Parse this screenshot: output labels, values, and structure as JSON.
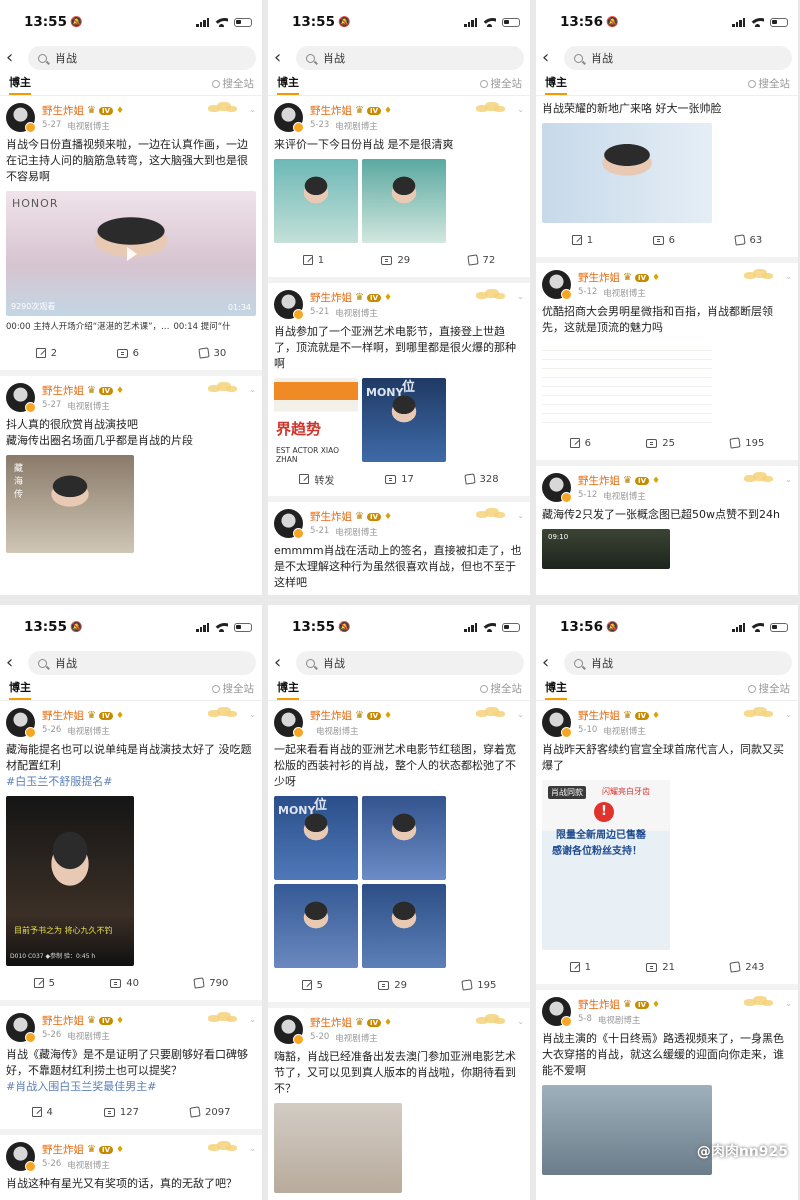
{
  "status": [
    {
      "time": "13:55"
    },
    {
      "time": "13:55"
    },
    {
      "time": "13:56"
    },
    {
      "time": "13:55"
    },
    {
      "time": "13:55"
    },
    {
      "time": "13:56"
    }
  ],
  "search": {
    "query": "肖战",
    "tab": "博主",
    "search_all": "搜全站"
  },
  "author": {
    "name": "野生炸姐",
    "source": "电视剧博主",
    "level": "IV"
  },
  "panels": [
    {
      "posts": [
        {
          "date": "5-27",
          "text": "肖战今日份直播视频来啦，一边在认真作画，一边在记主持人问的脑筋急转弯，这大脑强大到也是很不容易啊",
          "views": "9290次观看",
          "duration": "01:34",
          "watermark": "HONOR",
          "video_line_1": "00:00 主持人开场介绍“湛湛的艺术课”，…",
          "video_line_2": "00:14 提问“什",
          "share": "2",
          "comments": "6",
          "likes": "30"
        },
        {
          "date": "5-27",
          "text": "抖人真的很欣赏肖战演技吧\n藏海传出圈名场面几乎都是肖战的片段",
          "overlay": "藏\n海\n传"
        }
      ]
    },
    {
      "posts": [
        {
          "date": "5-23",
          "text": "来评价一下今日份肖战 是不是很清爽",
          "share": "1",
          "comments": "29",
          "likes": "72"
        },
        {
          "date": "5-21",
          "text": "肖战参加了一个亚洲艺术电影节，直接登上世趋了，顶流就是不一样啊，到哪里都是很火爆的那种啊",
          "banner_1": "界趋势",
          "banner_2": "EST ACTOR XIAO ZHAN",
          "banner_3": "MONY",
          "banner_4": "位",
          "share": "转发",
          "comments": "17",
          "likes": "328"
        },
        {
          "date": "5-21",
          "text": "emmmm肖战在活动上的签名，直接被扣走了，也是不太理解这种行为虽然很喜欢肖战，但也不至于这样吧"
        }
      ]
    },
    {
      "posts": [
        {
          "date": "",
          "text": "肖战荣耀的新地广来咯 好大一张帅脸",
          "share": "1",
          "comments": "6",
          "likes": "63"
        },
        {
          "date": "5-12",
          "text": "优酷招商大会男明星微指和百指，肖战都断层领先，这就是顶流的魅力吗",
          "share": "6",
          "comments": "25",
          "likes": "195"
        },
        {
          "date": "5-12",
          "text": "藏海传2只发了一张概念图已超50w点赞不到24h",
          "overlay": "09:10"
        }
      ]
    },
    {
      "posts": [
        {
          "date": "5-26",
          "text": "藏海能提名也可以说单纯是肖战演技太好了 没吃题材配置红利",
          "tag": "#白玉兰不舒服提名#",
          "caption": "目前予书之为 将心九久不钓",
          "caption_2": "D010  C037  ◆参制          验：0:45 h",
          "share": "5",
          "comments": "40",
          "likes": "790"
        },
        {
          "date": "5-26",
          "text": "肖战《藏海传》是不是证明了只要剧够好看口碑够好，不靠题材红利捞土也可以提奖？",
          "tag": "#肖战入围白玉兰奖最佳男主#",
          "share": "4",
          "comments": "127",
          "likes": "2097"
        },
        {
          "date": "5-26",
          "text": "肖战这种有星光又有奖项的话，真的无敌了吧？"
        }
      ]
    },
    {
      "posts": [
        {
          "date": "",
          "text": "一起来看看肖战的亚洲艺术电影节红毯图，穿着宽松版的西装衬衫的肖战，整个人的状态都松弛了不少呀",
          "banner_3": "MONY",
          "banner_4": "位",
          "share": "5",
          "comments": "29",
          "likes": "195"
        },
        {
          "date": "5-20",
          "text": "嗨豁，肖战已经准备出发去澳门参加亚洲电影艺术节了，又可以见到真人版本的肖战啦，你期待看到不？"
        }
      ]
    },
    {
      "posts": [
        {
          "date": "5-10",
          "text": "肖战昨天舒客续约官宣全球首席代言人，同款又买爆了",
          "ad_tag": "肖战同款",
          "ad_tag_2": "闪耀亮白牙齿",
          "ad_line_1": "限量全新周边已售罄",
          "ad_line_2": "感谢各位粉丝支持！",
          "share": "1",
          "comments": "21",
          "likes": "243"
        },
        {
          "date": "5-8",
          "text": "肖战主演的《十日终焉》路透视频来了，一身黑色大衣穿搭的肖战，就这么缓缓的迎面向你走来，谁能不爱啊",
          "watermark": "@肉肉nn925"
        }
      ]
    }
  ]
}
